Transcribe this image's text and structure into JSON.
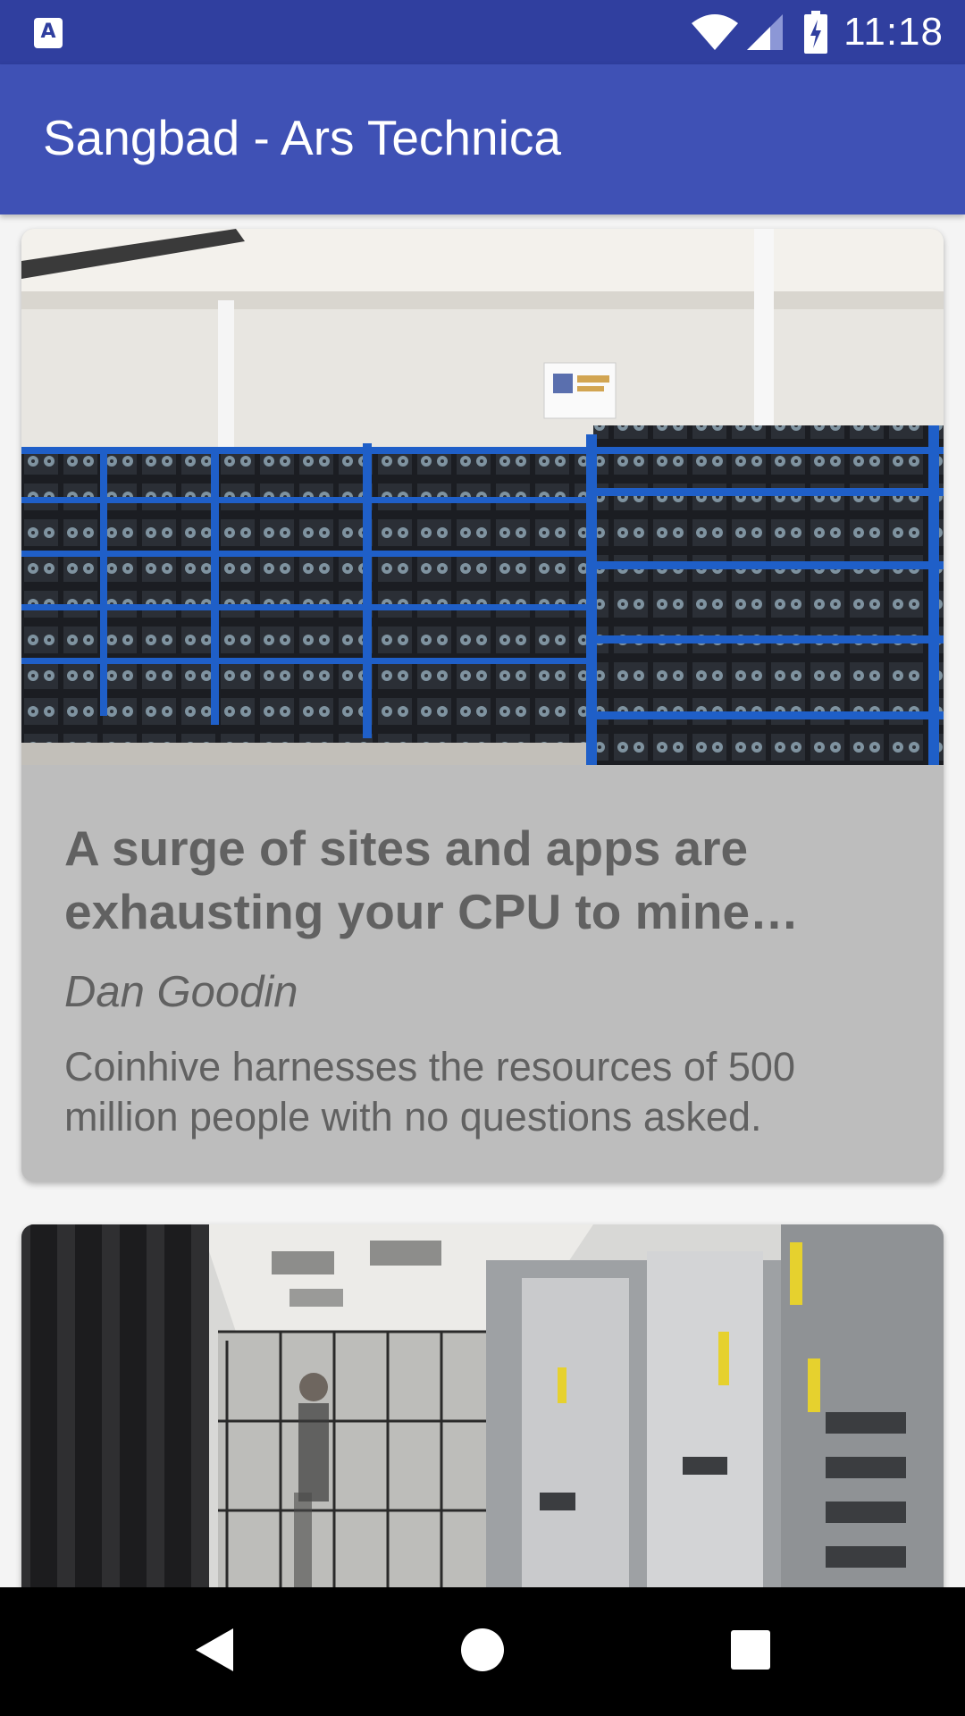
{
  "status_bar": {
    "time": "11:18",
    "notification_icon": "text-a-notification-icon",
    "notification_letter": "A",
    "icons": [
      "wifi-icon",
      "signal-icon",
      "battery-charging-icon"
    ]
  },
  "app_bar": {
    "title": "Sangbad - Ars Technica",
    "background_color": "#3f51b5",
    "status_color": "#303f9f"
  },
  "feed": {
    "articles": [
      {
        "image": "crypto-mining-rigs-image",
        "title": "A surge of sites and apps are exhausting your CPU to mine cryptocurrency",
        "author": "Dan Goodin",
        "summary": "Coinhive harnesses the resources of 500 million people with no questions asked."
      },
      {
        "image": "data-center-server-racks-image"
      }
    ]
  },
  "nav_bar": {
    "buttons": [
      "back-icon",
      "home-icon",
      "recents-icon"
    ]
  }
}
